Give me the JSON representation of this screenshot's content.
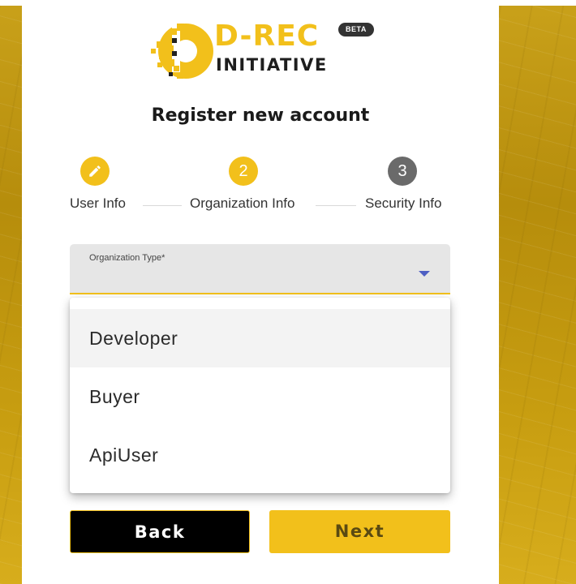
{
  "brand": {
    "title": "D-REC",
    "subtitle": "INITIATIVE",
    "badge": "BETA",
    "accent_color": "#f2c01b"
  },
  "page": {
    "title": "Register new account"
  },
  "stepper": {
    "steps": [
      {
        "icon": "pencil-icon",
        "number": "",
        "label": "User Info",
        "state": "completed"
      },
      {
        "icon": "",
        "number": "2",
        "label": "Organization Info",
        "state": "active"
      },
      {
        "icon": "",
        "number": "3",
        "label": "Security Info",
        "state": "inactive"
      }
    ]
  },
  "form": {
    "organization_type": {
      "label": "Organization Type*",
      "value": "",
      "options": [
        "Developer",
        "Buyer",
        "ApiUser"
      ],
      "highlighted_option": "Developer",
      "arrow_color": "#4e5fc3"
    }
  },
  "buttons": {
    "back": "Back",
    "next": "Next"
  }
}
